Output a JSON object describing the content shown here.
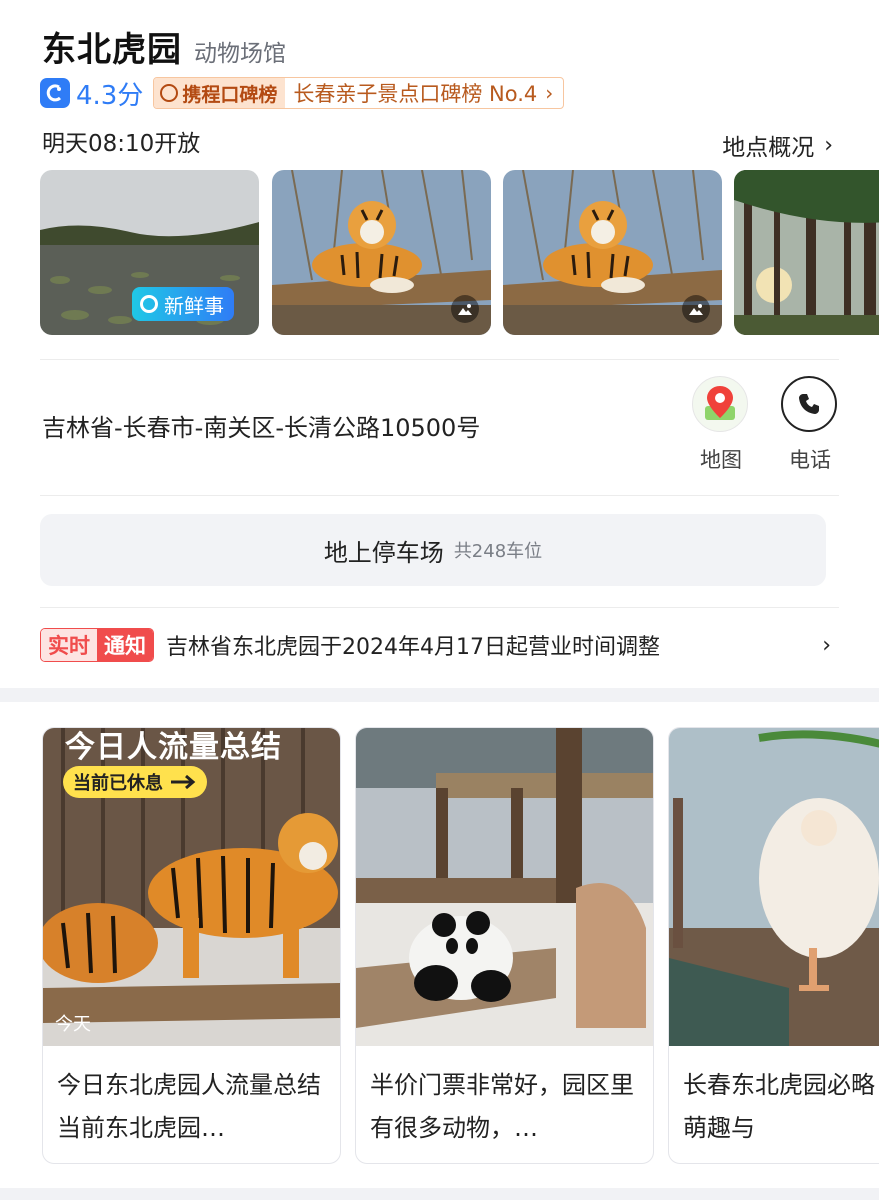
{
  "header": {
    "title": "东北虎园",
    "category": "动物场馆"
  },
  "rating": {
    "score": "4.3分",
    "brand": "携程口碑榜",
    "rank_text": "长春亲子景点口碑榜 No.4",
    "chevron": "›"
  },
  "hours": {
    "open_time": "明天08:10开放"
  },
  "overview": {
    "label": "地点概况",
    "chevron": "›"
  },
  "photos": {
    "fresh_tag": "新鲜事",
    "items": [
      {
        "name": "lake-photo"
      },
      {
        "name": "tiger-photo"
      },
      {
        "name": "tiger-photo-2"
      },
      {
        "name": "forest-photo"
      }
    ]
  },
  "location": {
    "address": "吉林省-长春市-南关区-长清公路10500号",
    "map_label": "地图",
    "phone_label": "电话"
  },
  "parking": {
    "name": "地上停车场",
    "count": "共248车位"
  },
  "notice": {
    "tag_left": "实时",
    "tag_right": "通知",
    "text": "吉林省东北虎园于2024年4月17日起营业时间调整",
    "chevron": "›"
  },
  "cards": [
    {
      "overlay_title": "今日人流量总结",
      "overlay_pill": "当前已休息",
      "overlay_date": "今天",
      "text": "今日东北虎园人流量总结 当前东北虎园…"
    },
    {
      "text": "半价门票非常好，园区里有很多动物，…"
    },
    {
      "text": "长春东北虎园必略｜猛兽萌趣与"
    }
  ],
  "colors": {
    "accent_blue": "#2f7cf6",
    "notice_red": "#f04c4c",
    "rank_orange": "#b85a1e"
  }
}
